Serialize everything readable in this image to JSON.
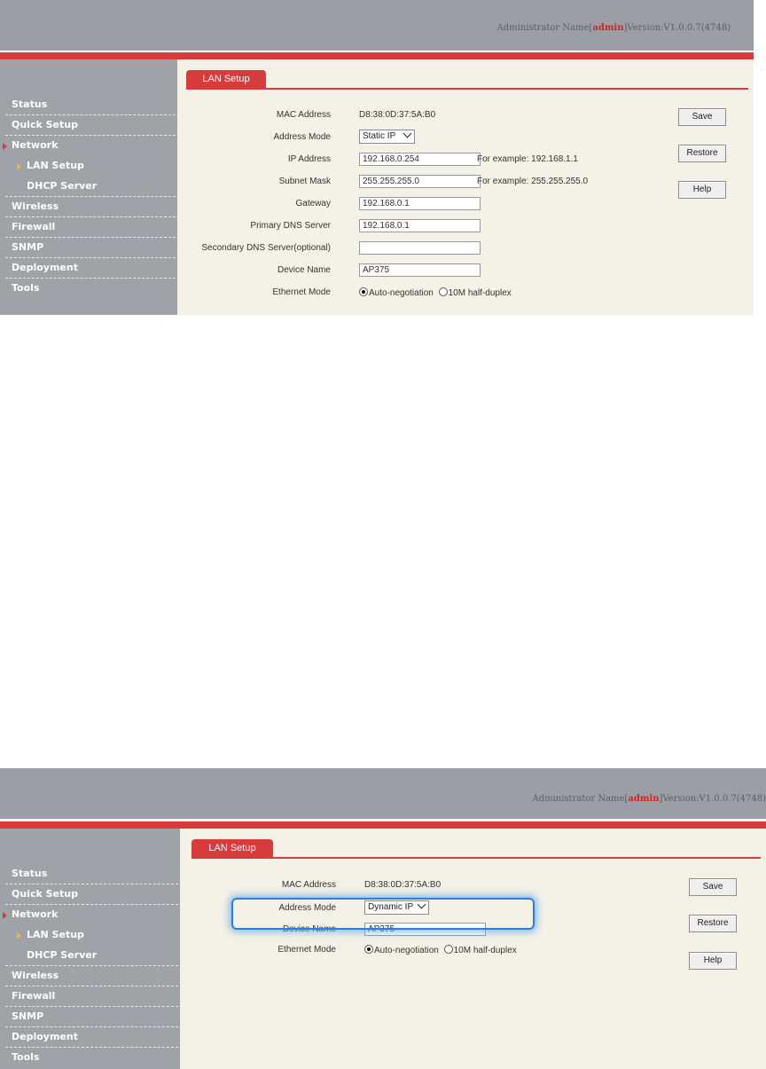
{
  "header": {
    "admin_prefix": "Administrator Name[",
    "admin_name": "admin",
    "version_text": "]Version:V1.0.0.7(4748)"
  },
  "sidebar": {
    "items": [
      {
        "label": "Status"
      },
      {
        "label": "Quick Setup"
      },
      {
        "label": "Network"
      },
      {
        "label": "LAN Setup"
      },
      {
        "label": "DHCP Server"
      },
      {
        "label": "Wireless"
      },
      {
        "label": "Firewall"
      },
      {
        "label": "SNMP"
      },
      {
        "label": "Deployment"
      },
      {
        "label": "Tools"
      }
    ]
  },
  "tab": {
    "label": "LAN Setup"
  },
  "buttons": {
    "save": "Save",
    "restore": "Restore",
    "help": "Help"
  },
  "form1": {
    "mac_label": "MAC Address",
    "mac_value": "D8:38:0D:37:5A:B0",
    "mode_label": "Address Mode",
    "mode_value": "Static IP",
    "ip_label": "IP Address",
    "ip_value": "192.168.0.254",
    "ip_hint": "For example: 192.168.1.1",
    "mask_label": "Subnet Mask",
    "mask_value": "255.255.255.0",
    "mask_hint": "For example: 255.255.255.0",
    "gw_label": "Gateway",
    "gw_value": "192.168.0.1",
    "dns1_label": "Primary DNS Server",
    "dns1_value": "192.168.0.1",
    "dns2_label": "Secondary DNS Server(optional)",
    "dns2_value": "",
    "name_label": "Device Name",
    "name_value": "AP375",
    "eth_label": "Ethernet Mode",
    "eth_auto": "Auto-negotiation",
    "eth_half": "10M half-duplex"
  },
  "form2": {
    "mac_label": "MAC Address",
    "mac_value": "D8:38:0D:37:5A:B0",
    "mode_label": "Address Mode",
    "mode_value": "Dynamic IP",
    "name_label": "Device Name",
    "name_value": "AP375",
    "eth_label": "Ethernet Mode",
    "eth_auto": "Auto-negotiation",
    "eth_half": "10M half-duplex"
  }
}
